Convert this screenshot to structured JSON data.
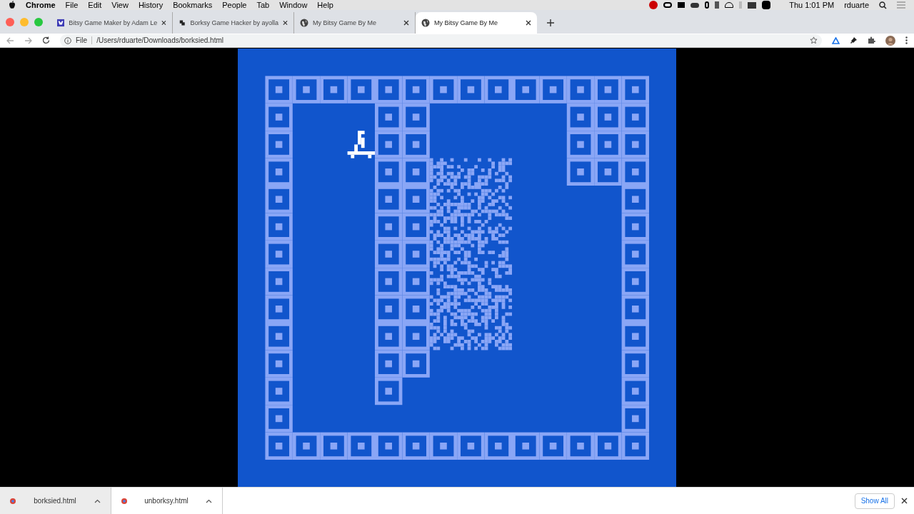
{
  "menu_bar": {
    "app": "Chrome",
    "items": [
      "File",
      "Edit",
      "View",
      "History",
      "Bookmarks",
      "People",
      "Tab",
      "Window",
      "Help"
    ],
    "clock": "Thu 1:01 PM",
    "user": "rduarte"
  },
  "tabs": [
    {
      "title": "Bitsy Game Maker by Adam Le",
      "selected": false
    },
    {
      "title": "Borksy Game Hacker by ayolla",
      "selected": false
    },
    {
      "title": "My Bitsy Game By Me",
      "selected": false
    },
    {
      "title": "My Bitsy Game By Me",
      "selected": true
    }
  ],
  "address_bar": {
    "scheme": "File",
    "url": "/Users/rduarte/Downloads/borksied.html"
  },
  "downloads": [
    {
      "name": "borksied.html"
    },
    {
      "name": "unborksy.html"
    }
  ],
  "downloads_button": "Show All"
}
